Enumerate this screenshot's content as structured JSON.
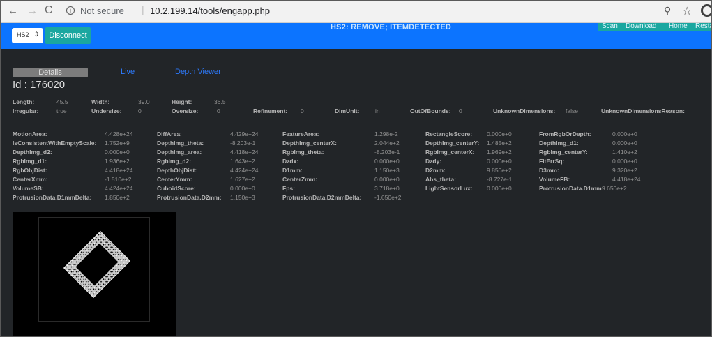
{
  "browser": {
    "back_glyph": "←",
    "forward_glyph": "→",
    "reload_glyph": "C",
    "security_label": "Not secure",
    "separator": "|",
    "url": "10.2.199.14/tools/engapp.php",
    "icons": [
      "back-icon",
      "forward-icon",
      "reload-icon",
      "info-icon",
      "zoom-icon",
      "star-icon",
      "profile-icon"
    ]
  },
  "header": {
    "device_select": "HS2",
    "disconnect_label": "Disconnect",
    "status_text": "HS2: REMOVE; ITEMDETECTED",
    "nav": [
      "Scan",
      "Download",
      "Home",
      "Resta"
    ],
    "colors": {
      "bar": "#0c74ff",
      "teal": "#1aa7a0"
    }
  },
  "tabs": {
    "details": "Details",
    "live": "Live",
    "depth_viewer": "Depth Viewer"
  },
  "record_id": "Id : 176020",
  "summary": [
    {
      "label": "Length:",
      "value": "45.5"
    },
    {
      "label": "Width:",
      "value": "39.0"
    },
    {
      "label": "Height:",
      "value": "36.5"
    },
    {
      "label": "Irregular:",
      "value": "true"
    },
    {
      "label": "Undersize:",
      "value": "0"
    },
    {
      "label": "Oversize:",
      "value": "0"
    },
    {
      "label": "Refinement:",
      "value": "0"
    },
    {
      "label": "DimUnit:",
      "value": "in"
    },
    {
      "label": "OutOfBounds:",
      "value": "0"
    },
    {
      "label": "UnknownDimensions:",
      "value": "false"
    },
    {
      "label": "UnknownDimensionsReason:",
      "value": ""
    }
  ],
  "metrics": [
    [
      {
        "label": "MotionArea:",
        "value": "4.428e+24"
      },
      {
        "label": "IsConsistentWithEmptyScale:",
        "value": "1.752e+9"
      },
      {
        "label": "DepthImg_d2:",
        "value": "0.000e+0"
      },
      {
        "label": "RgbImg_d1:",
        "value": "1.936e+2"
      },
      {
        "label": "RgbObjDist:",
        "value": "4.418e+24"
      },
      {
        "label": "CenterXmm:",
        "value": "-1.510e+2"
      },
      {
        "label": "VolumeSB:",
        "value": "4.424e+24"
      },
      {
        "label": "ProtrusionData.D1mmDelta:",
        "value": "1.850e+2"
      }
    ],
    [
      {
        "label": "DiffArea:",
        "value": "4.429e+24"
      },
      {
        "label": "DepthImg_theta:",
        "value": "-8.203e-1"
      },
      {
        "label": "DepthImg_area:",
        "value": "4.418e+24"
      },
      {
        "label": "RgbImg_d2:",
        "value": "1.643e+2"
      },
      {
        "label": "DepthObjDist:",
        "value": "4.424e+24"
      },
      {
        "label": "CenterYmm:",
        "value": "1.627e+2"
      },
      {
        "label": "CuboidScore:",
        "value": "0.000e+0"
      },
      {
        "label": "ProtrusionData.D2mm:",
        "value": "1.150e+3"
      }
    ],
    [
      {
        "label": "FeatureArea:",
        "value": "1.298e-2"
      },
      {
        "label": "DepthImg_centerX:",
        "value": "2.044e+2"
      },
      {
        "label": "RgbImg_theta:",
        "value": "-8.203e-1"
      },
      {
        "label": "Dzdx:",
        "value": "0.000e+0"
      },
      {
        "label": "D1mm:",
        "value": "1.150e+3"
      },
      {
        "label": "CenterZmm:",
        "value": "0.000e+0"
      },
      {
        "label": "Fps:",
        "value": "3.718e+0"
      },
      {
        "label": "ProtrusionData.D2mmDelta:",
        "value": "-1.650e+2"
      }
    ],
    [
      {
        "label": "RectangleScore:",
        "value": "0.000e+0"
      },
      {
        "label": "DepthImg_centerY:",
        "value": "1.485e+2"
      },
      {
        "label": "RgbImg_centerX:",
        "value": "1.969e+2"
      },
      {
        "label": "Dzdy:",
        "value": "0.000e+0"
      },
      {
        "label": "D2mm:",
        "value": "9.850e+2"
      },
      {
        "label": "Abs_theta:",
        "value": "-8.727e-1"
      },
      {
        "label": "LightSensorLux:",
        "value": "0.000e+0"
      }
    ],
    [
      {
        "label": "FromRgbOrDepth:",
        "value": "0.000e+0"
      },
      {
        "label": "DepthImg_d1:",
        "value": "0.000e+0"
      },
      {
        "label": "RgbImg_centerY:",
        "value": "1.410e+2"
      },
      {
        "label": "FitErrSq:",
        "value": "0.000e+0"
      },
      {
        "label": "D3mm:",
        "value": "9.320e+2"
      },
      {
        "label": "VolumeFB:",
        "value": "4.418e+24"
      },
      {
        "label": "ProtrusionData.D1mm:",
        "value": "9.650e+2"
      }
    ]
  ]
}
